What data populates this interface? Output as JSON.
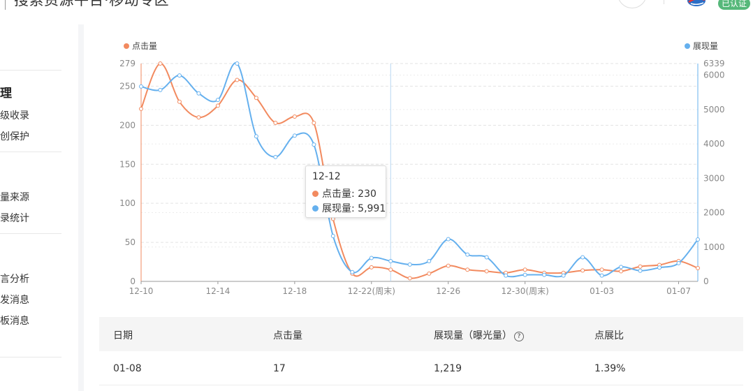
{
  "header": {
    "title": "搜索资源平台·移动专区",
    "verified_label": "已认证",
    "logo_icon": "site-logo-icon",
    "menu_icon": "menu-button-icon"
  },
  "sidebar": {
    "groups": [
      {
        "label": "理"
      }
    ],
    "items": [
      {
        "label": "级收录"
      },
      {
        "label": "创保护"
      },
      {
        "label": "量来源"
      },
      {
        "label": "录统计"
      },
      {
        "label": "言分析"
      },
      {
        "label": "发消息"
      },
      {
        "label": "板消息"
      }
    ]
  },
  "chart": {
    "legend_left": "点击量",
    "legend_right": "展现量",
    "tooltip": {
      "date": "12-12",
      "clicks_label": "点击量: 230",
      "impressions_label": "展现量: 5,991"
    }
  },
  "chart_data": {
    "type": "line",
    "x_tick_labels": [
      "12-10",
      "12-14",
      "12-18",
      "12-22(周末)",
      "12-26",
      "12-30(周末)",
      "01-03",
      "01-07"
    ],
    "x": [
      "12-10",
      "12-11",
      "12-12",
      "12-13",
      "12-14",
      "12-15",
      "12-16",
      "12-17",
      "12-18",
      "12-19",
      "12-20",
      "12-21",
      "12-22",
      "12-23",
      "12-24",
      "12-25",
      "12-26",
      "12-27",
      "12-28",
      "12-29",
      "12-30",
      "12-31",
      "01-01",
      "01-02",
      "01-03",
      "01-04",
      "01-05",
      "01-06",
      "01-07",
      "01-08"
    ],
    "series": [
      {
        "name": "点击量",
        "axis": "left",
        "color": "#f28a5f",
        "values": [
          221,
          279,
          230,
          210,
          225,
          258,
          235,
          203,
          211,
          203,
          80,
          10,
          18,
          15,
          4,
          10,
          20,
          15,
          13,
          11,
          15,
          11,
          11,
          14,
          15,
          13,
          19,
          21,
          26,
          17
        ]
      },
      {
        "name": "展现量",
        "axis": "right",
        "color": "#65b0ee",
        "values": [
          5670,
          5570,
          5991,
          5470,
          5280,
          6339,
          4220,
          3620,
          4240,
          3980,
          1320,
          270,
          680,
          590,
          490,
          590,
          1230,
          780,
          700,
          170,
          190,
          190,
          170,
          700,
          170,
          420,
          310,
          400,
          530,
          1219
        ]
      }
    ],
    "y_left": {
      "ticks": [
        0,
        50,
        100,
        150,
        200,
        250,
        279
      ],
      "range": [
        0,
        279
      ]
    },
    "y_right": {
      "ticks": [
        0,
        1000,
        2000,
        3000,
        4000,
        5000,
        6000,
        6339
      ],
      "range": [
        0,
        6339
      ]
    },
    "hover_index": 13,
    "grid": true,
    "legend_placement": "top-left and top-right"
  },
  "table": {
    "headers": [
      "日期",
      "点击量",
      "展现量（曝光量）",
      "点展比"
    ],
    "help_icon": "question-circle-icon",
    "rows": [
      [
        "01-08",
        "17",
        "1,219",
        "1.39%"
      ]
    ]
  }
}
